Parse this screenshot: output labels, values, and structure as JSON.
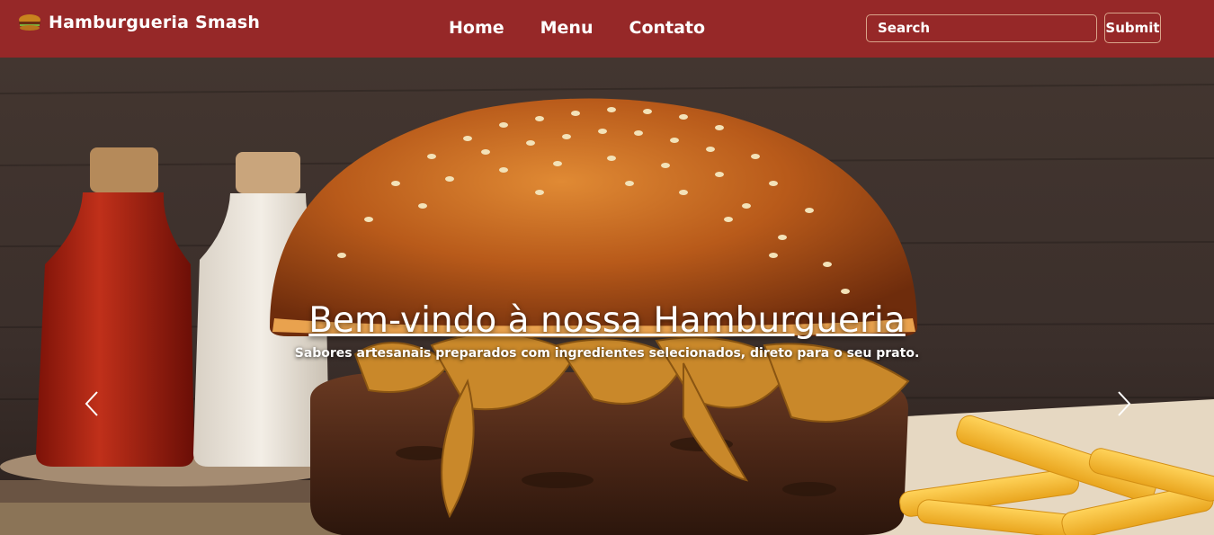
{
  "navbar": {
    "brand_name": "Hamburgueria Smash",
    "brand_icon": "burger-icon",
    "links": [
      {
        "label": "Home"
      },
      {
        "label": "Menu"
      },
      {
        "label": "Contato"
      }
    ],
    "search": {
      "placeholder": "Search",
      "value": ""
    },
    "submit_label": "Submit",
    "background_color": "#962828"
  },
  "hero": {
    "title": "Bem-vindo à nossa Hamburgueria",
    "subtitle": "Sabores artesanais preparados com ingredientes selecionados, direto para o seu prato.",
    "prev_icon": "chevron-left-icon",
    "next_icon": "chevron-right-icon"
  }
}
